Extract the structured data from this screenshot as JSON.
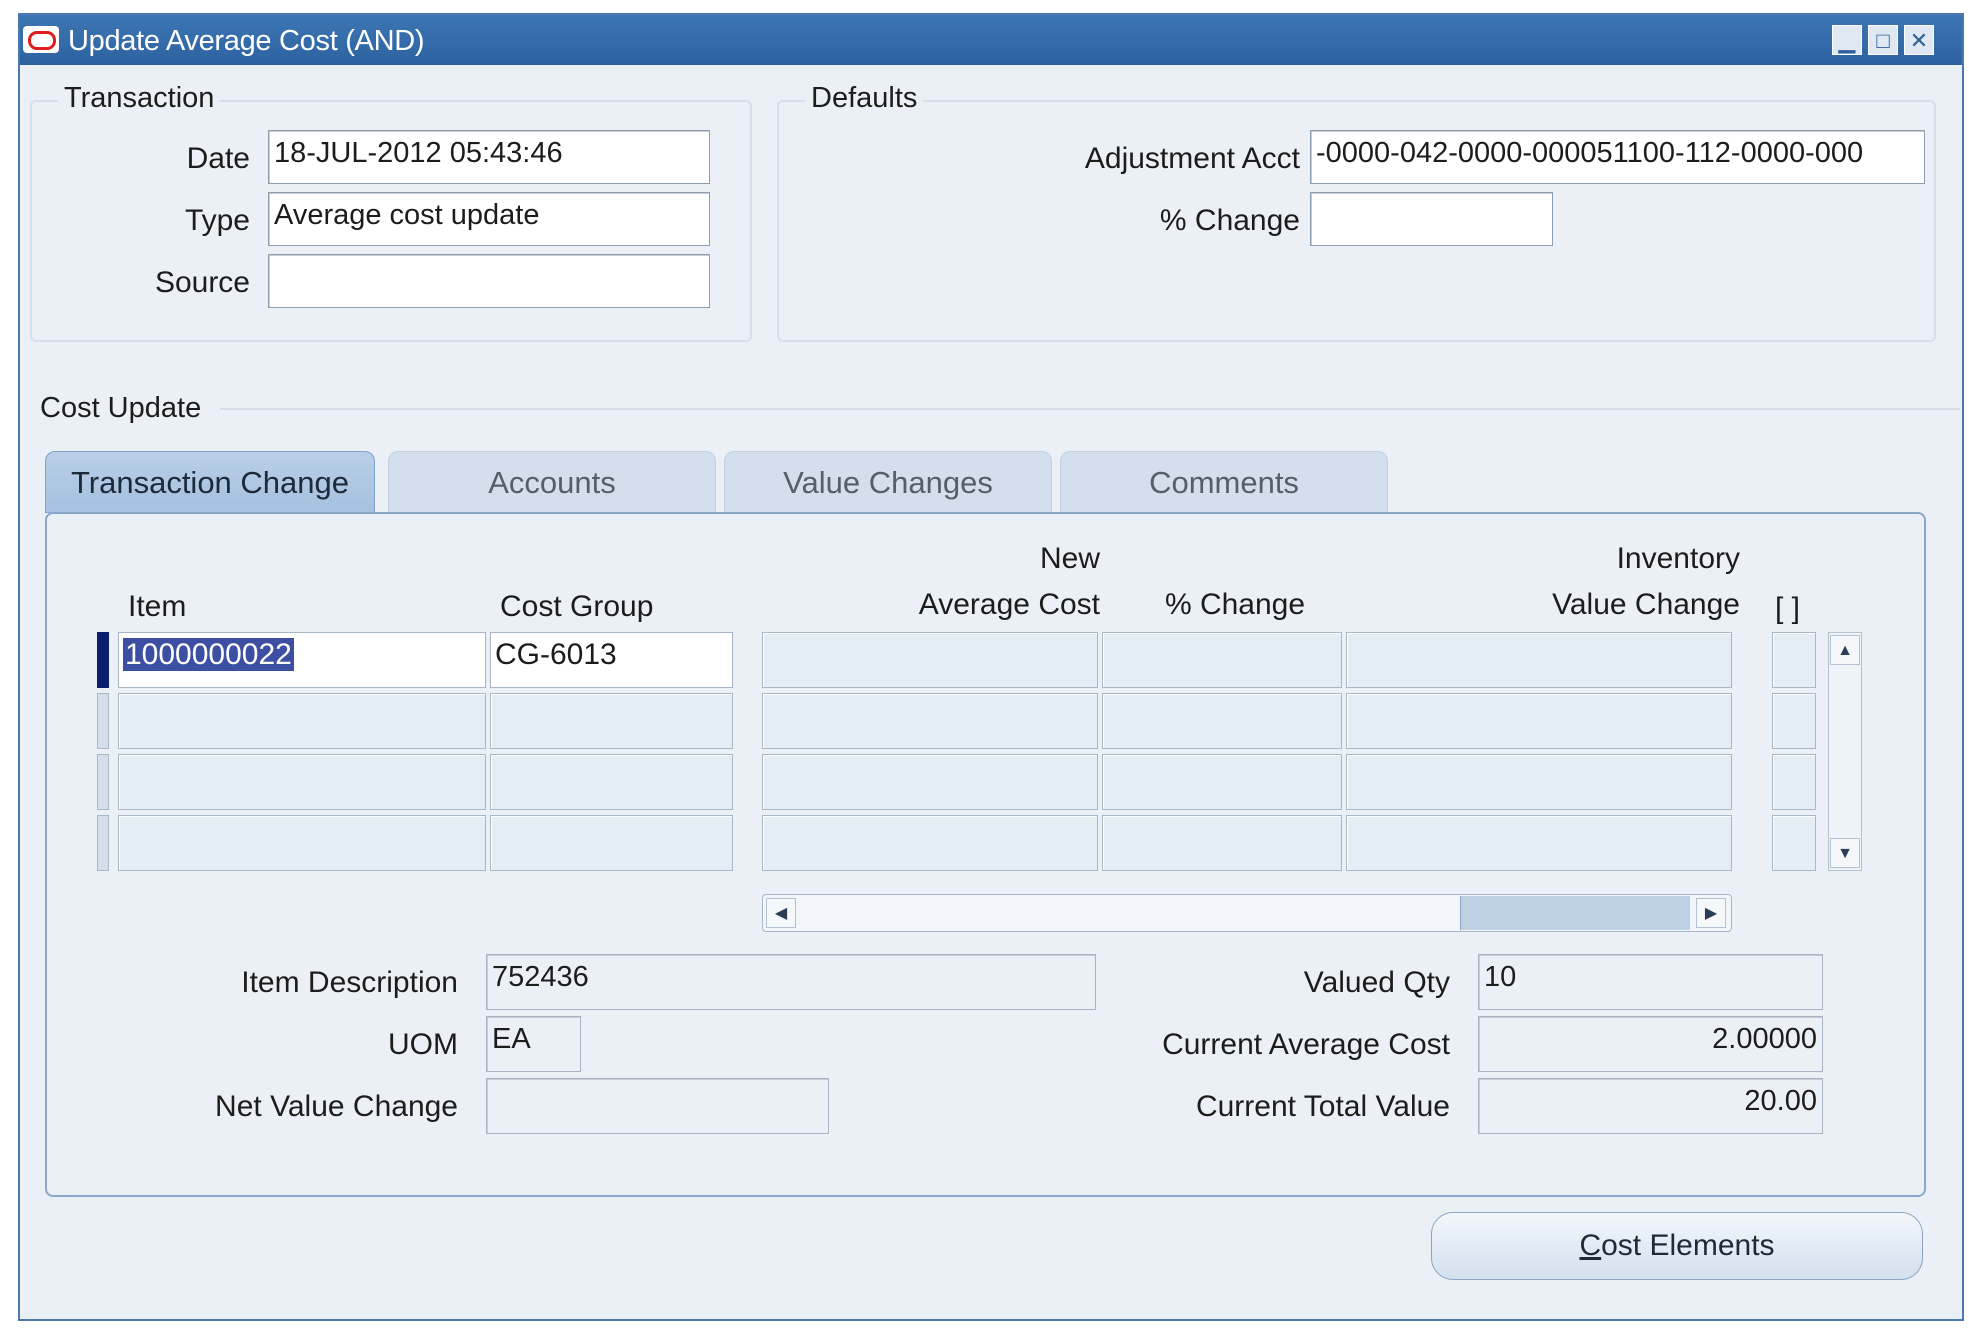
{
  "window": {
    "title": "Update Average Cost (AND)"
  },
  "transaction": {
    "group_label": "Transaction",
    "date_label": "Date",
    "date_value": "18-JUL-2012 05:43:46",
    "type_label": "Type",
    "type_value": "Average cost update",
    "source_label": "Source",
    "source_value": ""
  },
  "defaults": {
    "group_label": "Defaults",
    "adjustment_acct_label": "Adjustment Acct",
    "adjustment_acct_value": "-0000-042-0000-000051100-112-0000-000",
    "pct_change_label": "% Change",
    "pct_change_value": ""
  },
  "cost_update": {
    "section_label": "Cost Update",
    "tabs": [
      {
        "label": "Transaction Change",
        "active": true
      },
      {
        "label": "Accounts",
        "active": false
      },
      {
        "label": "Value Changes",
        "active": false
      },
      {
        "label": "Comments",
        "active": false
      }
    ],
    "columns": {
      "item": "Item",
      "cost_group": "Cost Group",
      "new_avg_cost_1": "New",
      "new_avg_cost_2": "Average Cost",
      "pct_change": "% Change",
      "inv_value_change_1": "Inventory",
      "inv_value_change_2": "Value Change",
      "flex": "[ ]"
    },
    "rows": [
      {
        "item": "1000000022",
        "cost_group": "CG-6013",
        "new_avg_cost": "",
        "pct_change": "",
        "inv_value_change": ""
      },
      {
        "item": "",
        "cost_group": "",
        "new_avg_cost": "",
        "pct_change": "",
        "inv_value_change": ""
      },
      {
        "item": "",
        "cost_group": "",
        "new_avg_cost": "",
        "pct_change": "",
        "inv_value_change": ""
      },
      {
        "item": "",
        "cost_group": "",
        "new_avg_cost": "",
        "pct_change": "",
        "inv_value_change": ""
      }
    ],
    "details": {
      "item_description_label": "Item Description",
      "item_description_value": "752436",
      "uom_label": "UOM",
      "uom_value": "EA",
      "net_value_change_label": "Net Value Change",
      "net_value_change_value": "",
      "valued_qty_label": "Valued Qty",
      "valued_qty_value": "10",
      "current_avg_cost_label": "Current Average Cost",
      "current_avg_cost_value": "2.00000",
      "current_total_value_label": "Current Total Value",
      "current_total_value_value": "20.00"
    }
  },
  "buttons": {
    "cost_elements_accel": "C",
    "cost_elements_rest": "ost Elements"
  },
  "icons": {
    "app": "oracle-logo-icon",
    "minimize": "minimize-icon",
    "maximize": "maximize-icon",
    "close": "close-icon"
  },
  "colors": {
    "titlebar": "#2d62a0",
    "window_bg": "#eaf0f6",
    "selection": "#3c4fa3",
    "active_tab": "#a5c1df"
  }
}
